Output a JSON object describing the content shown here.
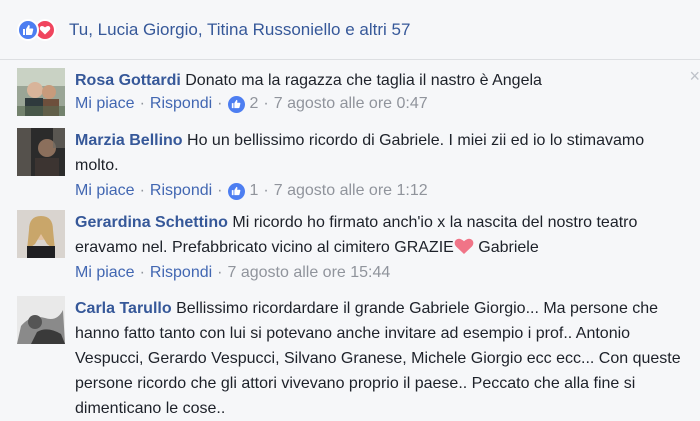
{
  "reactions": {
    "summary": "Tu, Lucia Giorgio, Titina Russoniello e altri 57",
    "icons": [
      "like-icon",
      "love-icon"
    ]
  },
  "comments": [
    {
      "author": "Rosa Gottardi",
      "text": "Donato ma la ragazza che taglia il nastro è Angela",
      "like_label": "Mi piace",
      "reply_label": "Rispondi",
      "like_count": "2",
      "timestamp": "7 agosto alle ore 0:47"
    },
    {
      "author": "Marzia Bellino",
      "text": "Ho un bellissimo ricordo di Gabriele. I miei zii ed io lo stimavamo molto.",
      "like_label": "Mi piace",
      "reply_label": "Rispondi",
      "like_count": "1",
      "timestamp": "7 agosto alle ore 1:12"
    },
    {
      "author": "Gerardina Schettino",
      "text_before": "Mi ricordo ho firmato anch'io x la nascita del nostro teatro eravamo nel. Prefabbricato vicino al cimitero GRAZIE",
      "text_after": " Gabriele",
      "like_label": "Mi piace",
      "reply_label": "Rispondi",
      "timestamp": "7 agosto alle ore 15:44"
    },
    {
      "author": "Carla Tarullo",
      "text": "Bellissimo ricordardare il grande Gabriele Giorgio... Ma persone che hanno fatto tanto con lui si potevano anche invitare ad esempio i prof.. Antonio Vespucci, Gerardo Vespucci, Silvano Granese, Michele Giorgio ecc ecc... Con queste persone ricordo che gli attori vivevano proprio il paese.. Peccato che alla fine si dimenticano le cose.."
    }
  ],
  "separator": "·",
  "close_glyph": "×",
  "colors": {
    "link": "#365899",
    "meta": "#90949c",
    "like_blue": "#4d7ef1",
    "love_red": "#f0455e"
  }
}
